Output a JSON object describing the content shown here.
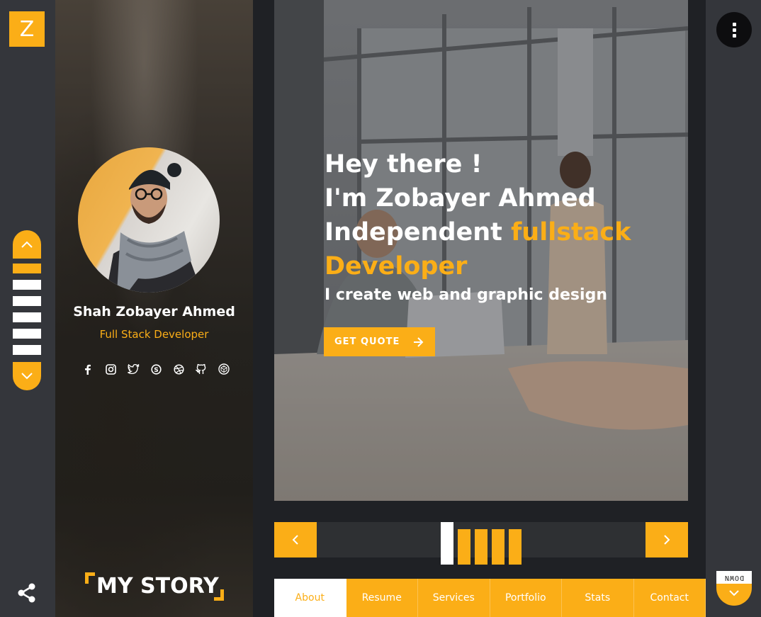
{
  "logo": {
    "letter": "Z"
  },
  "left_nav": {
    "items": 6,
    "active_index": 0
  },
  "profile": {
    "name": "Shah Zobayer Ahmed",
    "role": "Full Stack Developer",
    "socials": [
      "facebook-icon",
      "instagram-icon",
      "twitter-icon",
      "skype-icon",
      "dribbble-icon",
      "github-icon",
      "codepen-icon"
    ],
    "my_story": "MY STORY"
  },
  "hero": {
    "greeting": "Hey there !",
    "intro": "I'm Zobayer Ahmed",
    "title_plain": "Independent ",
    "title_accent_1": "fullstack",
    "title_accent_2": "Developer",
    "subtitle": "I create web and graphic design",
    "cta": "GET QUOTE"
  },
  "slider": {
    "count": 5,
    "active_index": 0
  },
  "tabs": [
    {
      "label": "About",
      "active": true
    },
    {
      "label": "Resume",
      "active": false
    },
    {
      "label": "Services",
      "active": false
    },
    {
      "label": "Portfolio",
      "active": false
    },
    {
      "label": "Stats",
      "active": false
    },
    {
      "label": "Contact",
      "active": false
    }
  ],
  "scroll_down": {
    "label": "DOWN"
  },
  "colors": {
    "accent": "#fbae17",
    "rail": "#34363b",
    "main_bg": "#1f2125",
    "white": "#ffffff"
  }
}
